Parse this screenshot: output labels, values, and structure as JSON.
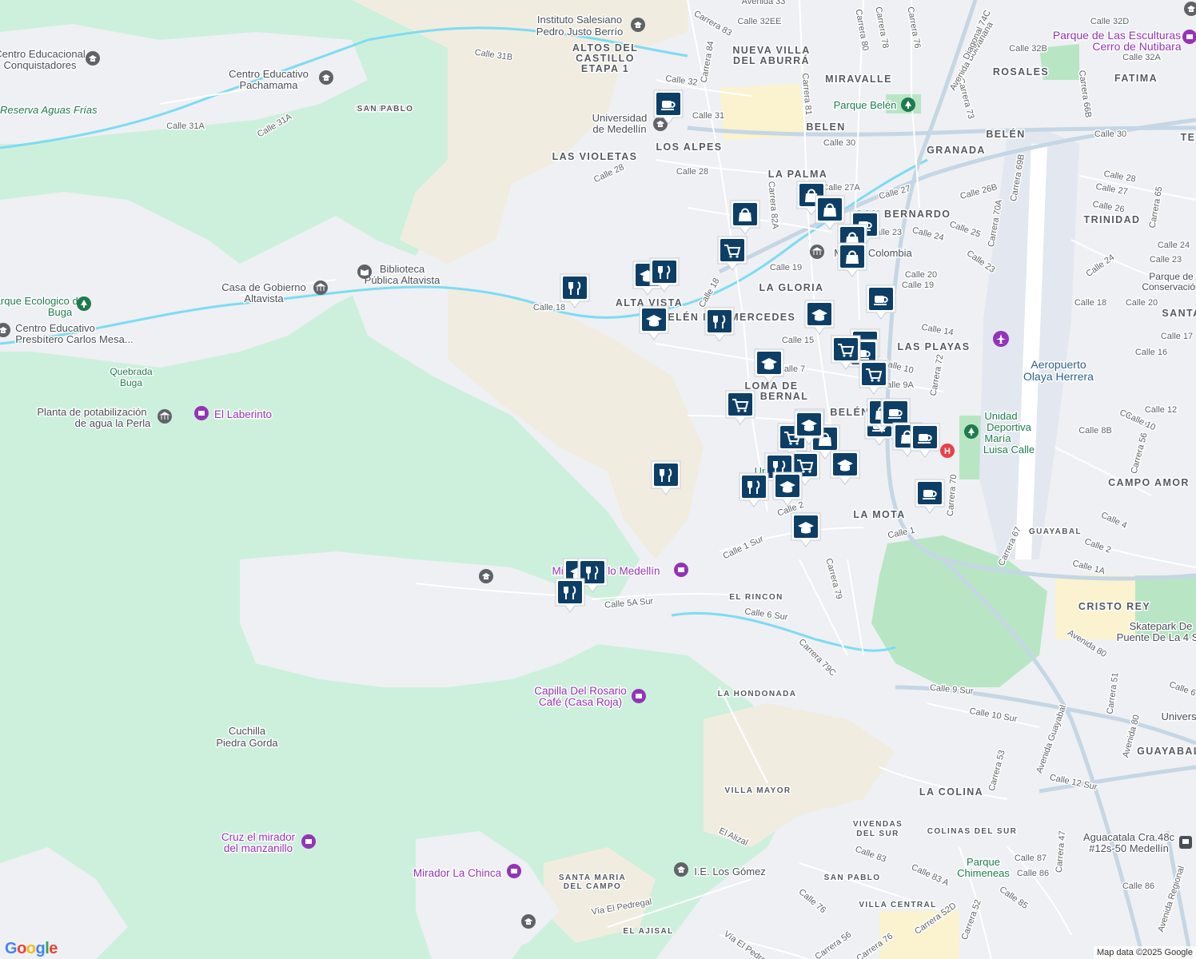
{
  "map": {
    "attribution": "Map data ©2025 Google",
    "logo": "Google",
    "colors": {
      "forest": "#cdf0dc",
      "hill": "#f1ece0",
      "urban": "#eef0f3",
      "park": "#b8e6c5",
      "river": "#7ddcf2",
      "road_major": "#c5d6e4",
      "road_minor": "#ffffff",
      "commercial": "#fbf2cf",
      "marker": "#0d3e66",
      "attraction": "#9334b8",
      "park_icon": "#1e7b4e",
      "hospital": "#e8414a"
    },
    "neighborhoods": [
      {
        "name": "ALTOS DEL"
      },
      {
        "name": "CASTILLO"
      },
      {
        "name": "ETAPA 1"
      },
      {
        "name": "NUEVA VILLA"
      },
      {
        "name": "DEL ABURRÁ"
      },
      {
        "name": "MIRAVALLE"
      },
      {
        "name": "ROSALES"
      },
      {
        "name": "FATIMA"
      },
      {
        "name": "BELEN"
      },
      {
        "name": "LOS ALPES"
      },
      {
        "name": "LAS VIOLETAS"
      },
      {
        "name": "GRANADA"
      },
      {
        "name": "BELÉN"
      },
      {
        "name": "LA PALMA"
      },
      {
        "name": "SAN BERNARDO"
      },
      {
        "name": "TRINIDAD"
      },
      {
        "name": "LA GLORIA"
      },
      {
        "name": "ALTA VISTA"
      },
      {
        "name": "R. BELÉN LAS MERCEDES"
      },
      {
        "name": "LAS PLAYAS"
      },
      {
        "name": "LOMA DE"
      },
      {
        "name": "BERNAL"
      },
      {
        "name": "BELÉN"
      },
      {
        "name": "CAMPO AMOR"
      },
      {
        "name": "LA MOTA"
      },
      {
        "name": "GUAYABAL"
      },
      {
        "name": "EL RINCON"
      },
      {
        "name": "CRISTO REY"
      },
      {
        "name": "LA HONDONADA"
      },
      {
        "name": "GUAYABAL"
      },
      {
        "name": "VILLA MAYOR"
      },
      {
        "name": "LA COLINA"
      },
      {
        "name": "VIVENDAS"
      },
      {
        "name": "DEL SUR"
      },
      {
        "name": "COLINAS DEL SUR"
      },
      {
        "name": "SAN PABLO"
      },
      {
        "name": "SANTA MARIA"
      },
      {
        "name": "DEL CAMPO"
      },
      {
        "name": "VILLA CENTRAL"
      },
      {
        "name": "EL AJISAL"
      },
      {
        "name": "SAN PABLO"
      }
    ],
    "streets": [
      {
        "name": "Calle 31B"
      },
      {
        "name": "Calle 31A"
      },
      {
        "name": "Calle 31A"
      },
      {
        "name": "Calle 32"
      },
      {
        "name": "Calle 31"
      },
      {
        "name": "Calle 28"
      },
      {
        "name": "Calle 28"
      },
      {
        "name": "Calle 30"
      },
      {
        "name": "Calle 30"
      },
      {
        "name": "Calle 27"
      },
      {
        "name": "Calle 27A"
      },
      {
        "name": "Calle 26B"
      },
      {
        "name": "Calle 23"
      },
      {
        "name": "Calle 24"
      },
      {
        "name": "Calle 25"
      },
      {
        "name": "Calle 23"
      },
      {
        "name": "Calle 19"
      },
      {
        "name": "Calle 20"
      },
      {
        "name": "Calle 19"
      },
      {
        "name": "Calle 18"
      },
      {
        "name": "Calle 18"
      },
      {
        "name": "Calle 15"
      },
      {
        "name": "Calle 14"
      },
      {
        "name": "Calle 10"
      },
      {
        "name": "Calle 9A"
      },
      {
        "name": "Calle 7"
      },
      {
        "name": "Calle 2"
      },
      {
        "name": "Calle 1 Sur"
      },
      {
        "name": "Calle 1"
      },
      {
        "name": "Calle 5A Sur"
      },
      {
        "name": "Calle 6 Sur"
      },
      {
        "name": "Calle 9 Sur"
      },
      {
        "name": "Calle 10 Sur"
      },
      {
        "name": "Calle 12 Sur"
      },
      {
        "name": "Calle 32D"
      },
      {
        "name": "Calle 32B"
      },
      {
        "name": "Calle 32A"
      },
      {
        "name": "Calle 32EE"
      },
      {
        "name": "Carrera 83"
      },
      {
        "name": "Carrera 84"
      },
      {
        "name": "Carrera 80"
      },
      {
        "name": "Carrera 78"
      },
      {
        "name": "Carrera 76"
      },
      {
        "name": "Carrera 81"
      },
      {
        "name": "Carrera 73"
      },
      {
        "name": "Carrera 66B"
      },
      {
        "name": "Carrera 82A"
      },
      {
        "name": "Carrera 69B"
      },
      {
        "name": "Carrera 70A"
      },
      {
        "name": "Carrera 65"
      },
      {
        "name": "Carrera 72"
      },
      {
        "name": "Carrera 70"
      },
      {
        "name": "Carrera 79"
      },
      {
        "name": "Carrera 79C"
      },
      {
        "name": "Carrera 53"
      },
      {
        "name": "Carrera 52"
      },
      {
        "name": "Carrera 52D"
      },
      {
        "name": "Carrera 47"
      },
      {
        "name": "Carrera 56"
      },
      {
        "name": "Carrera 76"
      },
      {
        "name": "Carrera 51"
      },
      {
        "name": "Carrera 67"
      },
      {
        "name": "Carrera 56"
      },
      {
        "name": "Avenida 33"
      },
      {
        "name": "Avenida Bolivariana"
      },
      {
        "name": "Diagonal 74C"
      },
      {
        "name": "Avenida 80"
      },
      {
        "name": "Avenida Guayabal"
      },
      {
        "name": "Avenida 80"
      },
      {
        "name": "Avenida Regional"
      },
      {
        "name": "Calle 8B"
      },
      {
        "name": "Calle 12"
      },
      {
        "name": "Calle 10"
      },
      {
        "name": "Calle 16"
      },
      {
        "name": "Calle 17"
      },
      {
        "name": "Calle 18"
      },
      {
        "name": "Calle 20"
      },
      {
        "name": "Calle 24"
      },
      {
        "name": "Calle 24"
      },
      {
        "name": "Calle 23"
      },
      {
        "name": "Calle 26"
      },
      {
        "name": "Calle 27"
      },
      {
        "name": "Calle 28"
      },
      {
        "name": "Calle 4"
      },
      {
        "name": "Calle 2"
      },
      {
        "name": "Calle 1A"
      },
      {
        "name": "Calle 6"
      },
      {
        "name": "Calle 83"
      },
      {
        "name": "Calle 83 A"
      },
      {
        "name": "Calle 87"
      },
      {
        "name": "Calle 86"
      },
      {
        "name": "Calle 86"
      },
      {
        "name": "Calle 85"
      },
      {
        "name": "Calle 76"
      },
      {
        "name": "El Alizal"
      },
      {
        "name": "Vía El Pedregal"
      },
      {
        "name": "Vía El Pedregal"
      },
      {
        "name": "Calle 10"
      }
    ],
    "places": [
      {
        "name": "Instituto Salesiano",
        "kind": "school-icon"
      },
      {
        "name": "Pedro Justo Berrío",
        "kind": ""
      },
      {
        "name": "Centro Educacional",
        "kind": "school-icon"
      },
      {
        "name": "Conquistadores",
        "kind": ""
      },
      {
        "name": "Centro Educativo",
        "kind": "school-icon"
      },
      {
        "name": "Pachamama",
        "kind": ""
      },
      {
        "name": "SAN PABLO",
        "kind": ""
      },
      {
        "name": "Reserva Aguas Frías",
        "kind": ""
      },
      {
        "name": "Universidad",
        "kind": "school-icon"
      },
      {
        "name": "de Medellín",
        "kind": ""
      },
      {
        "name": "Parque Belén",
        "kind": "park-icon"
      },
      {
        "name": "Parque de Las Esculturas",
        "kind": "attraction-icon"
      },
      {
        "name": "Cerro de Nutibara",
        "kind": ""
      },
      {
        "name": "Biblioteca",
        "kind": "library-icon"
      },
      {
        "name": "Pública Altavista",
        "kind": ""
      },
      {
        "name": "Casa de Gobierno",
        "kind": "government-icon"
      },
      {
        "name": "Altavista",
        "kind": ""
      },
      {
        "name": "Parque Ecologico de",
        "kind": "park-icon"
      },
      {
        "name": "Buga",
        "kind": ""
      },
      {
        "name": "Centro Educativo",
        "kind": "school-icon"
      },
      {
        "name": "Presbítero Carlos Mesa...",
        "kind": ""
      },
      {
        "name": "Quebrada",
        "kind": ""
      },
      {
        "name": "Buga",
        "kind": ""
      },
      {
        "name": "Planta de potabilización",
        "kind": "government-icon"
      },
      {
        "name": "de agua la Perla",
        "kind": ""
      },
      {
        "name": "El Laberinto",
        "kind": "attraction-icon"
      },
      {
        "name": "Museo Colombia",
        "kind": "museum-icon"
      },
      {
        "name": "Parque de",
        "kind": ""
      },
      {
        "name": "Conservación",
        "kind": ""
      },
      {
        "name": "Aeropuerto",
        "kind": ""
      },
      {
        "name": "Olaya Herrera",
        "kind": "airport-icon"
      },
      {
        "name": "Unidad",
        "kind": ""
      },
      {
        "name": "Deportiva",
        "kind": "park-icon"
      },
      {
        "name": "María",
        "kind": ""
      },
      {
        "name": "Luisa Calle",
        "kind": ""
      },
      {
        "name": "Universidad",
        "kind": ""
      },
      {
        "name": "Mirador Cielo Medellín",
        "kind": "attraction-icon"
      },
      {
        "name": "Skatepark De",
        "kind": ""
      },
      {
        "name": "Puente De La 4 S",
        "kind": ""
      },
      {
        "name": "Capilla Del Rosario",
        "kind": "attraction-icon"
      },
      {
        "name": "Café (Casa Roja)",
        "kind": ""
      },
      {
        "name": "Cuchilla",
        "kind": ""
      },
      {
        "name": "Piedra Gorda",
        "kind": ""
      },
      {
        "name": "Cruz el mirador",
        "kind": "attraction-icon"
      },
      {
        "name": "del manzanillo",
        "kind": ""
      },
      {
        "name": "Mirador La Chinca",
        "kind": "attraction-icon"
      },
      {
        "name": "I.E. Los Gómez",
        "kind": "school-icon"
      },
      {
        "name": "Parque",
        "kind": ""
      },
      {
        "name": "Chimeneas",
        "kind": ""
      },
      {
        "name": "Aguacatala Cra.48c",
        "kind": "transit-icon"
      },
      {
        "name": "#12s-50 Medellín",
        "kind": ""
      },
      {
        "name": "Universi",
        "kind": ""
      },
      {
        "name": "SANTA",
        "kind": ""
      },
      {
        "name": "TE",
        "kind": ""
      }
    ],
    "markers": [
      {
        "type": "coffee-icon"
      },
      {
        "type": "restaurant-icon"
      },
      {
        "type": "school-icon"
      },
      {
        "type": "school-icon"
      },
      {
        "type": "restaurant-icon"
      },
      {
        "type": "shopping-bag-icon"
      },
      {
        "type": "shopping-cart-icon"
      },
      {
        "type": "shopping-bag-icon"
      },
      {
        "type": "shopping-bag-icon"
      },
      {
        "type": "coffee-icon"
      },
      {
        "type": "shopping-bag-icon"
      },
      {
        "type": "shopping-bag-icon"
      },
      {
        "type": "coffee-icon"
      },
      {
        "type": "school-icon"
      },
      {
        "type": "restaurant-icon"
      },
      {
        "type": "school-icon"
      },
      {
        "type": "shopping-cart-icon"
      },
      {
        "type": "coffee-icon"
      },
      {
        "type": "coffee-icon"
      },
      {
        "type": "shopping-cart-icon"
      },
      {
        "type": "shopping-cart-icon"
      },
      {
        "type": "coffee-icon"
      },
      {
        "type": "shopping-bag-icon"
      },
      {
        "type": "shopping-cart-icon"
      },
      {
        "type": "shopping-cart-icon"
      },
      {
        "type": "shopping-bag-icon"
      },
      {
        "type": "coffee-icon"
      },
      {
        "type": "shopping-bag-icon"
      },
      {
        "type": "coffee-icon"
      },
      {
        "type": "restaurant-icon"
      },
      {
        "type": "shopping-cart-icon"
      },
      {
        "type": "school-icon"
      },
      {
        "type": "restaurant-icon"
      },
      {
        "type": "school-icon"
      },
      {
        "type": "school-icon"
      },
      {
        "type": "coffee-icon"
      },
      {
        "type": "restaurant-icon"
      },
      {
        "type": "school-icon"
      },
      {
        "type": "restaurant-icon"
      },
      {
        "type": "restaurant-icon"
      },
      {
        "type": "school-icon"
      }
    ]
  }
}
